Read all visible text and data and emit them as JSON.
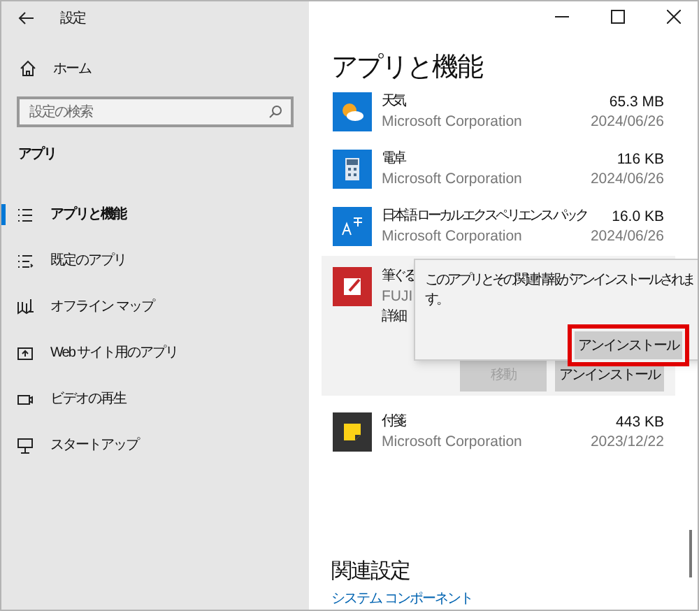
{
  "window": {
    "title": "設定"
  },
  "sidebar": {
    "home": "ホーム",
    "search": {
      "placeholder": "設定の検索"
    },
    "section": "アプリ",
    "items": [
      {
        "label": "アプリと機能",
        "selected": true
      },
      {
        "label": "既定のアプリ",
        "selected": false
      },
      {
        "label": "オフライン マップ",
        "selected": false
      },
      {
        "label": "Web サイト用のアプリ",
        "selected": false
      },
      {
        "label": "ビデオの再生",
        "selected": false
      },
      {
        "label": "スタートアップ",
        "selected": false
      }
    ]
  },
  "main": {
    "title": "アプリと機能",
    "apps": [
      {
        "name": "天気",
        "publisher": "Microsoft Corporation",
        "size": "65.3 MB",
        "date": "2024/06/26",
        "selected": false
      },
      {
        "name": "電卓",
        "publisher": "Microsoft Corporation",
        "size": "116 KB",
        "date": "2024/06/26",
        "selected": false
      },
      {
        "name": "日本語 ローカル エクスペリエンス パック",
        "publisher": "Microsoft Corporation",
        "size": "16.0 KB",
        "date": "2024/06/26",
        "selected": false
      },
      {
        "name": "筆ぐる",
        "publisher": "FUJI",
        "details": "詳細",
        "selected": true,
        "buttons": [
          {
            "label": "移動",
            "disabled": true
          },
          {
            "label": "アンインストール",
            "disabled": false
          }
        ],
        "popup": {
          "message": "このアプリとその関連情報がアンインストールされます。",
          "button": "アンインストール",
          "highlighted": true
        }
      },
      {
        "name": "付箋",
        "publisher": "Microsoft Corporation",
        "size": "443 KB",
        "date": "2023/12/22",
        "selected": false
      }
    ],
    "related": {
      "heading": "関連設定",
      "link": "システム コンポーネント"
    }
  }
}
